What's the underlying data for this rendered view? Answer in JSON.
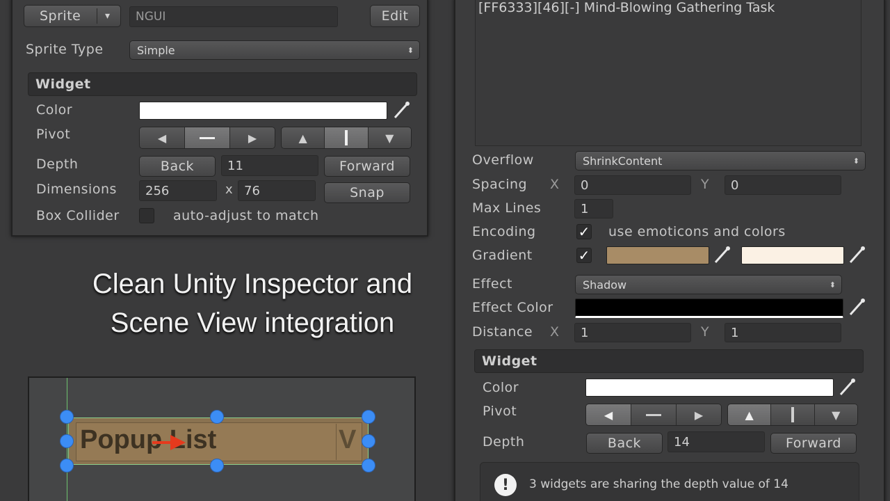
{
  "left_inspector": {
    "sprite_dropdown": "Sprite",
    "sprite_dropdown_arrow": "▾",
    "atlas_field": "NGUI",
    "edit_button": "Edit",
    "sprite_type_label": "Sprite Type",
    "sprite_type_value": "Simple",
    "widget": {
      "header": "Widget",
      "color_label": "Color",
      "color_value": "#ffffff",
      "pivot_label": "Pivot",
      "depth_label": "Depth",
      "depth_back": "Back",
      "depth_value": "11",
      "depth_forward": "Forward",
      "dimensions_label": "Dimensions",
      "dim_width": "256",
      "dim_x": "x",
      "dim_height": "76",
      "snap_button": "Snap",
      "box_collider_label": "Box Collider",
      "auto_adjust_label": "auto-adjust to match"
    }
  },
  "headline": {
    "line1": "Clean Unity Inspector and",
    "line2": "Scene View integration"
  },
  "scene_view": {
    "popup_text": "Popup List",
    "popup_suffix": "V"
  },
  "right_inspector": {
    "text_content": "[FF6333][46][-] Mind-Blowing Gathering Task",
    "overflow_label": "Overflow",
    "overflow_value": "ShrinkContent",
    "spacing_label": "Spacing",
    "spacing_x_label": "X",
    "spacing_x": "0",
    "spacing_y_label": "Y",
    "spacing_y": "0",
    "max_lines_label": "Max Lines",
    "max_lines": "1",
    "encoding_label": "Encoding",
    "encoding_checked": true,
    "encoding_text": "use emoticons and colors",
    "gradient_label": "Gradient",
    "gradient_checked": true,
    "gradient_top": "#a88c66",
    "gradient_bottom": "#fbf1e4",
    "effect_label": "Effect",
    "effect_value": "Shadow",
    "effect_color_label": "Effect Color",
    "effect_color": "#000000",
    "distance_label": "Distance",
    "distance_x_label": "X",
    "distance_x": "1",
    "distance_y_label": "Y",
    "distance_y": "1",
    "widget": {
      "header": "Widget",
      "color_label": "Color",
      "color_value": "#ffffff",
      "pivot_label": "Pivot",
      "depth_label": "Depth",
      "depth_back": "Back",
      "depth_value": "14",
      "depth_forward": "Forward",
      "info_text": "3 widgets are sharing the depth value of 14"
    }
  },
  "icons": {
    "eyedropper": "eyedropper-icon",
    "arrow_left": "arrow-left-icon",
    "arrow_right": "arrow-right-icon",
    "arrow_up": "arrow-up-icon",
    "arrow_down": "arrow-down-icon",
    "info": "info-icon",
    "checkmark": "checkmark-icon"
  }
}
